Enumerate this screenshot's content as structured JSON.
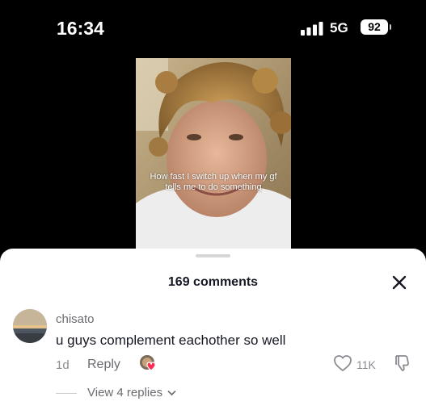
{
  "status_bar": {
    "time": "16:34",
    "network": "5G",
    "battery": "92",
    "icons": [
      "signal-icon",
      "battery-icon"
    ]
  },
  "video": {
    "caption": "How fast I switch up when my gf tells me to do something"
  },
  "comments_sheet": {
    "title": "169 comments",
    "close_icon": "close-icon"
  },
  "comment": {
    "username": "chisato",
    "text": "u guys complement eachother so well",
    "time": "1d",
    "reply_label": "Reply",
    "likes": "11K",
    "view_replies": "View 4 replies"
  },
  "colors": {
    "background": "#000000",
    "sheet": "#ffffff",
    "primary_text": "#161823",
    "secondary_text": "#6b6b70",
    "heart_accent": "#fe2c55"
  }
}
